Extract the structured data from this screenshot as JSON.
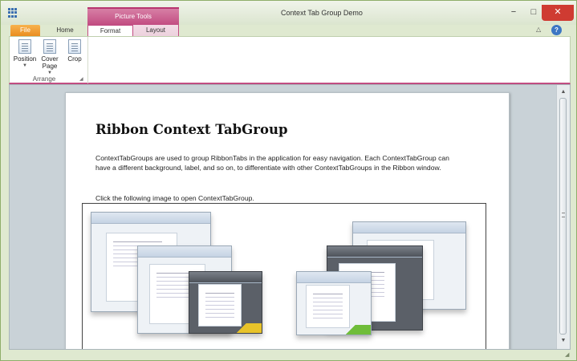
{
  "window": {
    "title": "Context Tab Group Demo",
    "minimize": "−",
    "maximize": "□",
    "close": "✕"
  },
  "ribbon": {
    "context_group_label": "Picture Tools",
    "tabs": [
      {
        "label": "File"
      },
      {
        "label": "Home"
      },
      {
        "label": "Format",
        "selected": true
      },
      {
        "label": "Layout"
      }
    ],
    "groups": [
      {
        "label": "Arrange",
        "buttons": [
          {
            "label": "Position",
            "has_dropdown": true
          },
          {
            "label": "Cover Page",
            "has_dropdown": true
          },
          {
            "label": "Crop",
            "has_dropdown": false
          }
        ]
      }
    ],
    "help_icon": "?",
    "minimize_ribbon_icon": "△"
  },
  "document": {
    "title": "Ribbon Context TabGroup",
    "paragraph": "ContextTabGroups are used to group RibbonTabs in the application for easy navigation. Each ContextTabGroup can have a different background, label, and so on, to differentiate with other ContextTabGroups in the Ribbon window.",
    "link_text": "Click the following image to open ContextTabGroup."
  },
  "colors": {
    "context_accent": "#c24d82",
    "file_tab": "#e98a1d",
    "window_frame": "#dfe9d0",
    "close_button": "#cf3b32"
  }
}
